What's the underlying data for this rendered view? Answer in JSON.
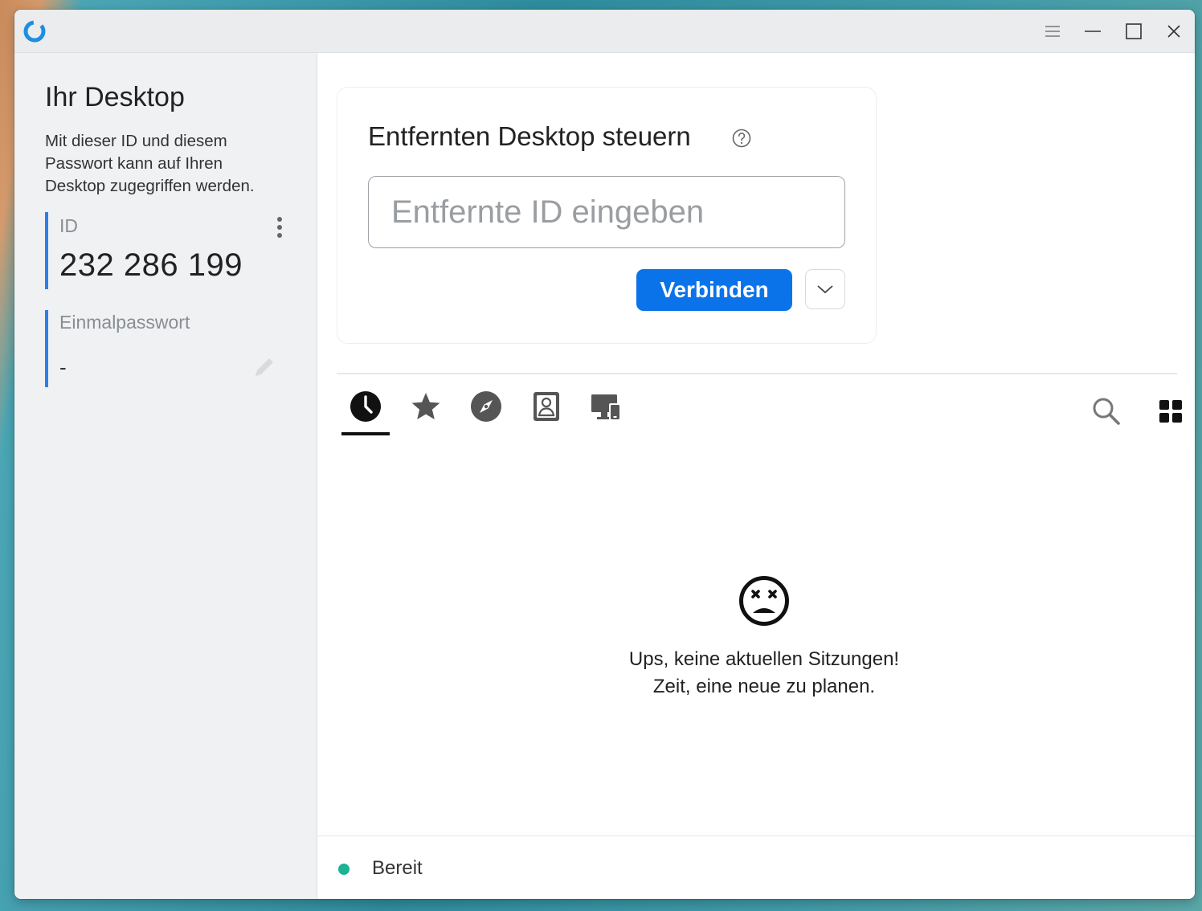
{
  "colors": {
    "accent": "#0b73ea",
    "id_bar": "#2a80e8",
    "status_ready": "#1ab394",
    "sidebar_bg": "#eff1f3"
  },
  "titlebar": {
    "app_icon": "app-logo-icon",
    "controls": [
      "menu-icon",
      "minimize-icon",
      "maximize-icon",
      "close-icon"
    ]
  },
  "sidebar": {
    "title": "Ihr Desktop",
    "description": "Mit dieser ID und diesem\nPasswort kann auf Ihren\nDesktop zugegriffen werden.",
    "id_label": "ID",
    "id_value": "232 286 199",
    "password_label": "Einmalpasswort",
    "password_value": "-"
  },
  "connect": {
    "title": "Entfernten Desktop steuern",
    "input_placeholder": "Entfernte ID eingeben",
    "input_value": "",
    "connect_label": "Verbinden"
  },
  "tabs": [
    {
      "name": "recent-sessions",
      "icon": "clock-icon",
      "active": true
    },
    {
      "name": "favorites",
      "icon": "star-icon",
      "active": false
    },
    {
      "name": "discovered",
      "icon": "compass-icon",
      "active": false
    },
    {
      "name": "address-book",
      "icon": "contact-icon",
      "active": false
    },
    {
      "name": "devices",
      "icon": "devices-icon",
      "active": false
    }
  ],
  "empty_state": {
    "icon": "dizzy-face-icon",
    "line1": "Ups, keine aktuellen Sitzungen!",
    "line2": "Zeit, eine neue zu planen."
  },
  "status": {
    "text": "Bereit"
  }
}
